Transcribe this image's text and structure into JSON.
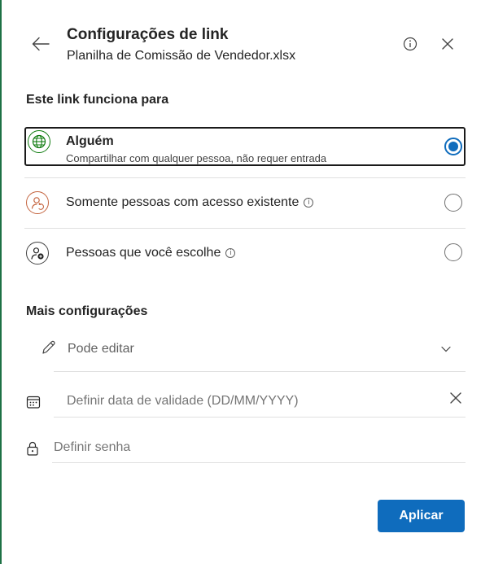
{
  "header": {
    "title": "Configurações de link",
    "subtitle": "Planilha de Comissão de Vendedor.xlsx",
    "back_icon": "arrow-left-icon",
    "info_icon": "info-icon",
    "close_icon": "close-icon"
  },
  "link_works_for": {
    "heading": "Este link funciona para",
    "options": [
      {
        "label": "Alguém",
        "description": "Compartilhar com qualquer pessoa, não requer entrada",
        "icon": "globe-icon",
        "selected": true
      },
      {
        "label": "Somente pessoas com acesso existente",
        "icon": "person-refresh-icon",
        "selected": false
      },
      {
        "label": "Pessoas que você escolhe",
        "icon": "person-add-icon",
        "selected": false
      }
    ]
  },
  "more_settings": {
    "heading": "Mais configurações",
    "permission": {
      "value": "Pode editar",
      "icon": "pencil-icon"
    },
    "expiration": {
      "placeholder": "Definir data de validade (DD/MM/YYYY)",
      "icon": "calendar-icon"
    },
    "password": {
      "placeholder": "Definir senha",
      "icon": "lock-icon"
    }
  },
  "footer": {
    "apply_label": "Aplicar"
  },
  "colors": {
    "accent": "#0f6cbd",
    "edge": "#1e7145",
    "globe": "#107c10",
    "person": "#c4643f"
  }
}
